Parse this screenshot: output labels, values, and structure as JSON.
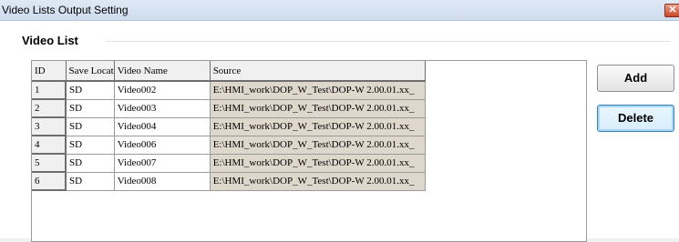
{
  "window": {
    "title": "Video Lists Output Setting",
    "close_glyph": "✕"
  },
  "group": {
    "label": "Video List"
  },
  "table": {
    "columns": [
      "ID",
      "Save Locat",
      "Video Name",
      "Source"
    ],
    "rows": [
      {
        "id": "1",
        "save_location": "SD",
        "video_name": "Video002",
        "source": "E:\\HMI_work\\DOP_W_Test\\DOP-W 2.00.01.xx_"
      },
      {
        "id": "2",
        "save_location": "SD",
        "video_name": "Video003",
        "source": "E:\\HMI_work\\DOP_W_Test\\DOP-W 2.00.01.xx_"
      },
      {
        "id": "3",
        "save_location": "SD",
        "video_name": "Video004",
        "source": "E:\\HMI_work\\DOP_W_Test\\DOP-W 2.00.01.xx_"
      },
      {
        "id": "4",
        "save_location": "SD",
        "video_name": "Video006",
        "source": "E:\\HMI_work\\DOP_W_Test\\DOP-W 2.00.01.xx_"
      },
      {
        "id": "5",
        "save_location": "SD",
        "video_name": "Video007",
        "source": "E:\\HMI_work\\DOP_W_Test\\DOP-W 2.00.01.xx_"
      },
      {
        "id": "6",
        "save_location": "SD",
        "video_name": "Video008",
        "source": "E:\\HMI_work\\DOP_W_Test\\DOP-W 2.00.01.xx_"
      }
    ]
  },
  "buttons": {
    "add": "Add",
    "delete": "Delete"
  },
  "colors": {
    "source_cell_bg": "#ded7cc",
    "focus_border": "#3c7fb1",
    "close_button": "#c8452b"
  }
}
